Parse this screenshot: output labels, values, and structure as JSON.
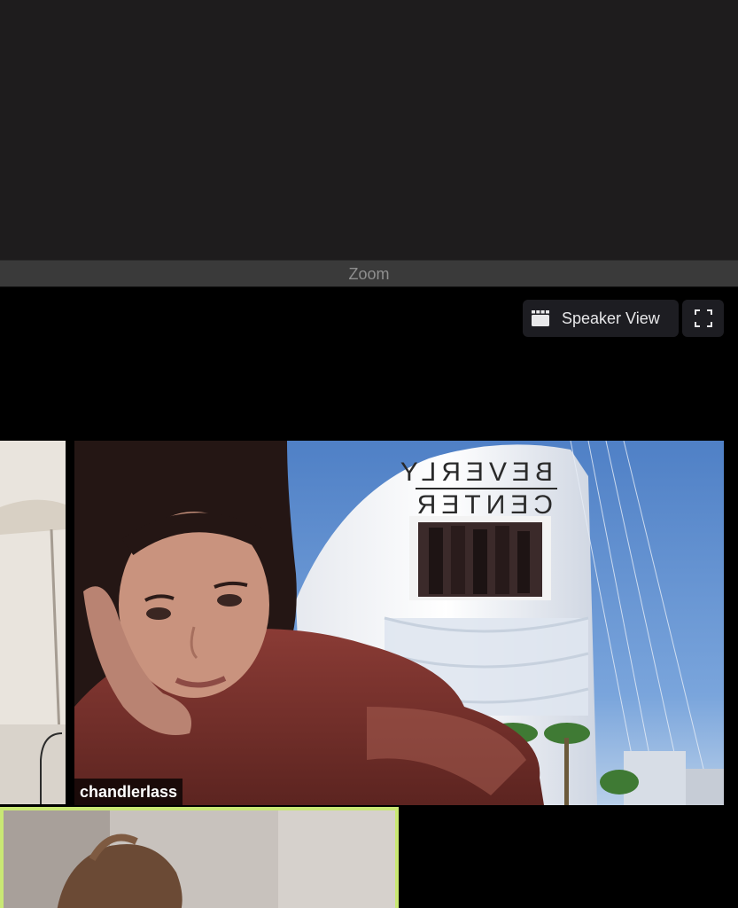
{
  "window": {
    "title": "Zoom"
  },
  "toolbar": {
    "speaker_view_label": "Speaker View",
    "speaker_view_icon": "grid-icon",
    "fullscreen_icon": "fullscreen-icon"
  },
  "participants": {
    "main_name": "chandlerlass"
  },
  "background": {
    "sign_line1": "BEVERLY",
    "sign_line2": "CENTER"
  },
  "colors": {
    "active_speaker_border": "#c9e874",
    "titlebar": "#3a3a3a",
    "button_bg": "#1d1d22"
  }
}
